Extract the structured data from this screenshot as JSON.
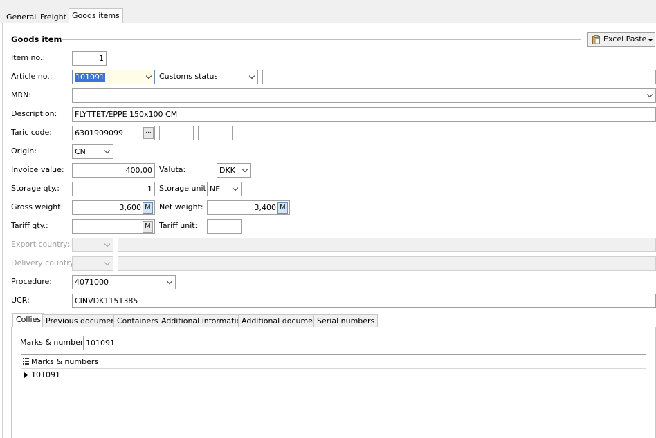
{
  "tabs": [
    "General",
    "Freight",
    "Goods items"
  ],
  "section_title": "Goods item",
  "excel_paste_label": "Excel Paste",
  "labels": {
    "item_no": "Item no.:",
    "article_no": "Article no.:",
    "customs_status": "Customs status:",
    "mrn": "MRN:",
    "description": "Description:",
    "taric_code": "Taric code:",
    "origin": "Origin:",
    "invoice_value": "Invoice value:",
    "valuta": "Valuta:",
    "storage_qty": "Storage qty.:",
    "storage_unit": "Storage unit:",
    "gross_weight": "Gross weight:",
    "net_weight": "Net weight:",
    "tariff_qty": "Tariff qty.:",
    "tariff_unit": "Tariff unit:",
    "export_country": "Export country:",
    "delivery_country": "Delivery country:",
    "procedure": "Procedure:",
    "ucr": "UCR:",
    "marks_numbers": "Marks & numbers:"
  },
  "values": {
    "item_no": "1",
    "article_no": "101091",
    "customs_status": "",
    "customs_status_text": "",
    "mrn": "",
    "description": "FLYTTETÆPPE 150x100 CM",
    "taric_code": "6301909099",
    "taric_ellipsis": "...",
    "origin": "CN",
    "invoice_value": "400,00",
    "valuta": "DKK",
    "storage_qty": "1",
    "storage_unit": "NE",
    "gross_weight": "3,600",
    "net_weight": "3,400",
    "m_label": "M",
    "tariff_qty": "",
    "tariff_unit": "",
    "procedure": "4071000",
    "ucr": "CINVDK1151385",
    "marks_numbers": "101091"
  },
  "sub_tabs": [
    "Collies",
    "Previous document",
    "Containers",
    "Additional information",
    "Additional document",
    "Serial numbers"
  ],
  "grid": {
    "column_header": "Marks & numbers",
    "rows": [
      "101091"
    ]
  }
}
